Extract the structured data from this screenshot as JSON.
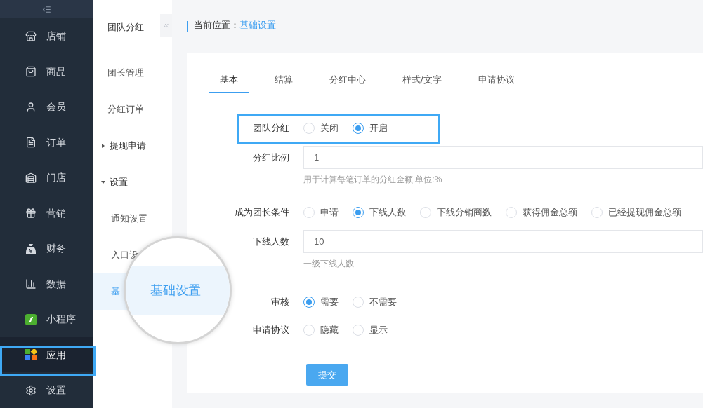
{
  "sidebar": {
    "items": [
      {
        "label": "店铺",
        "selected": false
      },
      {
        "label": "商品",
        "selected": false
      },
      {
        "label": "会员",
        "selected": false
      },
      {
        "label": "订单",
        "selected": false
      },
      {
        "label": "门店",
        "selected": false
      },
      {
        "label": "营销",
        "selected": false
      },
      {
        "label": "财务",
        "selected": false
      },
      {
        "label": "数据",
        "selected": false
      },
      {
        "label": "小程序",
        "selected": false
      },
      {
        "label": "应用",
        "selected": true
      },
      {
        "label": "设置",
        "selected": false
      }
    ]
  },
  "subnav": {
    "title": "团队分红",
    "items": [
      {
        "kind": "link",
        "label": "团长管理",
        "selected": false
      },
      {
        "kind": "link",
        "label": "分红订单",
        "selected": false
      },
      {
        "kind": "group",
        "label": "提现申请",
        "selected": false,
        "expanded": false
      },
      {
        "kind": "group",
        "label": "设置",
        "selected": false,
        "expanded": true,
        "children": [
          {
            "label": "通知设置",
            "selected": false
          },
          {
            "label": "入口设",
            "selected": false
          },
          {
            "label": "基",
            "selected": true
          }
        ]
      }
    ]
  },
  "breadcrumb": {
    "label": "当前位置：",
    "current": "基础设置"
  },
  "tabs": [
    {
      "label": "基本",
      "selected": true
    },
    {
      "label": "结算",
      "selected": false
    },
    {
      "label": "分红中心",
      "selected": false
    },
    {
      "label": "样式/文字",
      "selected": false
    },
    {
      "label": "申请协议",
      "selected": false
    }
  ],
  "form": [
    {
      "kind": "radio",
      "label": "团队分红",
      "options": [
        {
          "label": "关闭",
          "selected": false
        },
        {
          "label": "开启",
          "selected": true
        }
      ]
    },
    {
      "kind": "input",
      "label": "分红比例",
      "value": "1",
      "hint": "用于计算每笔订单的分红金额 单位:%"
    },
    {
      "kind": "radio",
      "label": "成为团长条件",
      "options": [
        {
          "label": "申请",
          "selected": false
        },
        {
          "label": "下线人数",
          "selected": true
        },
        {
          "label": "下线分销商数",
          "selected": false
        },
        {
          "label": "获得佣金总额",
          "selected": false
        },
        {
          "label": "已经提现佣金总额",
          "selected": false
        }
      ]
    },
    {
      "kind": "input",
      "label": "下线人数",
      "value": "10",
      "hint": "一级下线人数"
    },
    {
      "kind": "radio",
      "label": "审核",
      "options": [
        {
          "label": "需要",
          "selected": true
        },
        {
          "label": "不需要",
          "selected": false
        }
      ]
    },
    {
      "kind": "radio",
      "label": "申请协议",
      "options": [
        {
          "label": "隐藏",
          "selected": false
        },
        {
          "label": "显示",
          "selected": false
        }
      ]
    }
  ],
  "submit": "提交",
  "magnifier": {
    "text": "基础设置"
  }
}
